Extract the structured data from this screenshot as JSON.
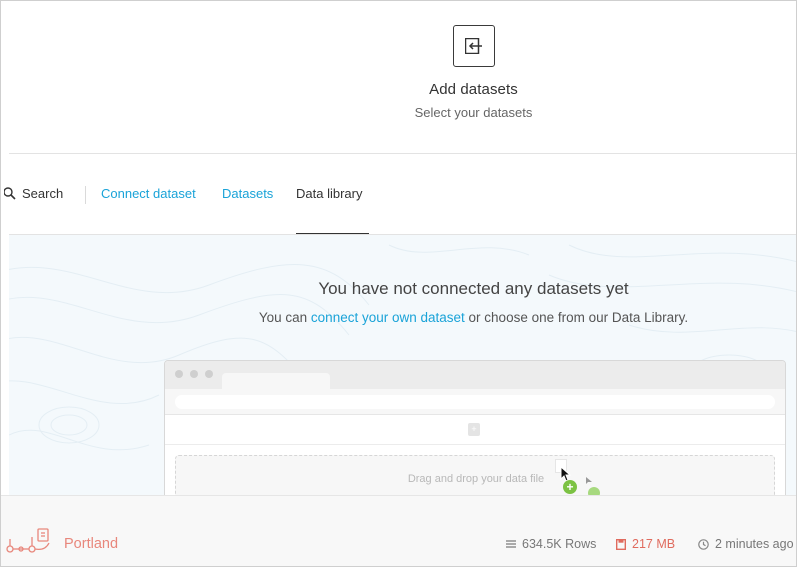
{
  "header": {
    "title": "Add datasets",
    "subtitle": "Select your datasets",
    "icon": "import-icon"
  },
  "tabs": {
    "search_label": "Search",
    "items": [
      {
        "label": "Connect dataset",
        "active": false
      },
      {
        "label": "Datasets",
        "active": false
      },
      {
        "label": "Data library",
        "active": true
      }
    ]
  },
  "main": {
    "heading": "You have not connected any datasets yet",
    "text_prefix": "You can",
    "link_text": "connect your own dataset",
    "text_suffix": "or choose one from our Data Library."
  },
  "illustration": {
    "dropzone_text": "Drag and drop your data file"
  },
  "footer": {
    "dataset_name": "Portland",
    "rows": "634.5K Rows",
    "size": "217 MB",
    "time": "2 minutes ago"
  },
  "colors": {
    "accent": "#1aa3d8",
    "footer_name": "#e8877c",
    "size": "#e06b5e",
    "main_bg": "#f4f9fc"
  }
}
